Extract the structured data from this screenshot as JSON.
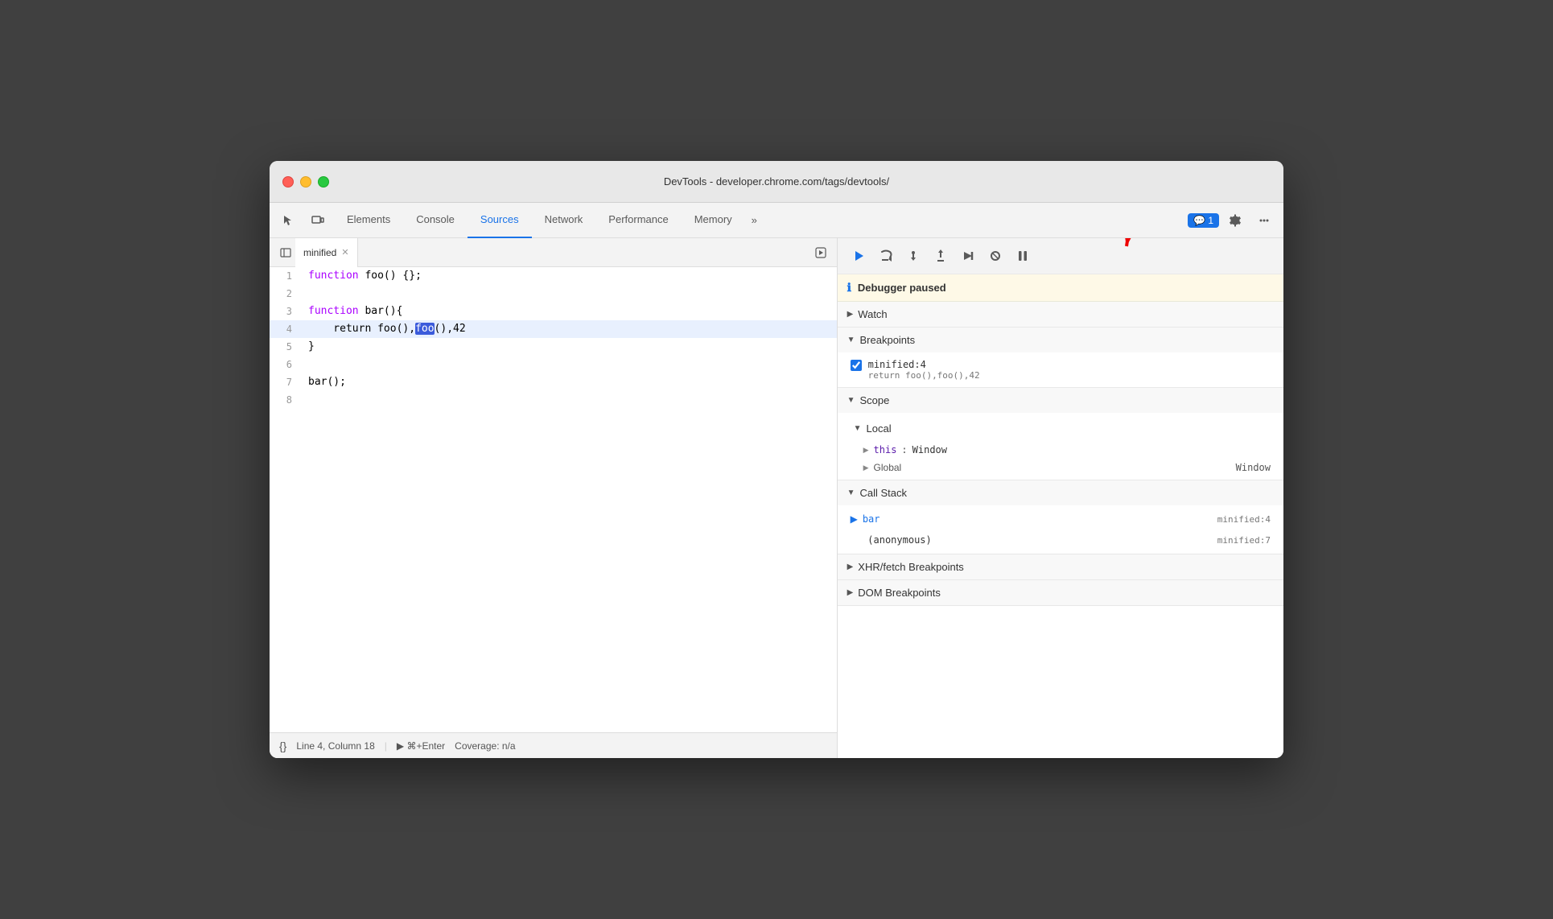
{
  "window": {
    "title": "DevTools - developer.chrome.com/tags/devtools/"
  },
  "tabs": {
    "list": [
      {
        "id": "elements",
        "label": "Elements",
        "active": false
      },
      {
        "id": "console",
        "label": "Console",
        "active": false
      },
      {
        "id": "sources",
        "label": "Sources",
        "active": true
      },
      {
        "id": "network",
        "label": "Network",
        "active": false
      },
      {
        "id": "performance",
        "label": "Performance",
        "active": false
      },
      {
        "id": "memory",
        "label": "Memory",
        "active": false
      }
    ],
    "overflow": "»",
    "notification": "💬 1"
  },
  "editor": {
    "tab_name": "minified",
    "lines": [
      {
        "num": "1",
        "content": "function foo() {};"
      },
      {
        "num": "2",
        "content": ""
      },
      {
        "num": "3",
        "content": "function bar(){"
      },
      {
        "num": "4",
        "content": "    return foo(),foo(),42",
        "highlighted": true
      },
      {
        "num": "5",
        "content": "}"
      },
      {
        "num": "6",
        "content": ""
      },
      {
        "num": "7",
        "content": "bar();"
      },
      {
        "num": "8",
        "content": ""
      }
    ]
  },
  "status_bar": {
    "icon": "{}",
    "position": "Line 4, Column 18",
    "run_label": "▶ ⌘+Enter",
    "coverage": "Coverage: n/a"
  },
  "debugger": {
    "paused_msg": "Debugger paused",
    "sections": {
      "watch": "Watch",
      "breakpoints": "Breakpoints",
      "scope": "Scope",
      "local": "Local",
      "global": "Global",
      "global_val": "Window",
      "call_stack": "Call Stack",
      "xhr_breakpoints": "XHR/fetch Breakpoints",
      "dom_breakpoints": "DOM Breakpoints"
    },
    "breakpoint": {
      "location": "minified:4",
      "code": "return foo(),foo(),42"
    },
    "scope": {
      "this_key": "this",
      "this_val": "Window"
    },
    "call_stack": [
      {
        "name": "bar",
        "location": "minified:4",
        "active": true
      },
      {
        "name": "(anonymous)",
        "location": "minified:7",
        "active": false
      }
    ]
  }
}
